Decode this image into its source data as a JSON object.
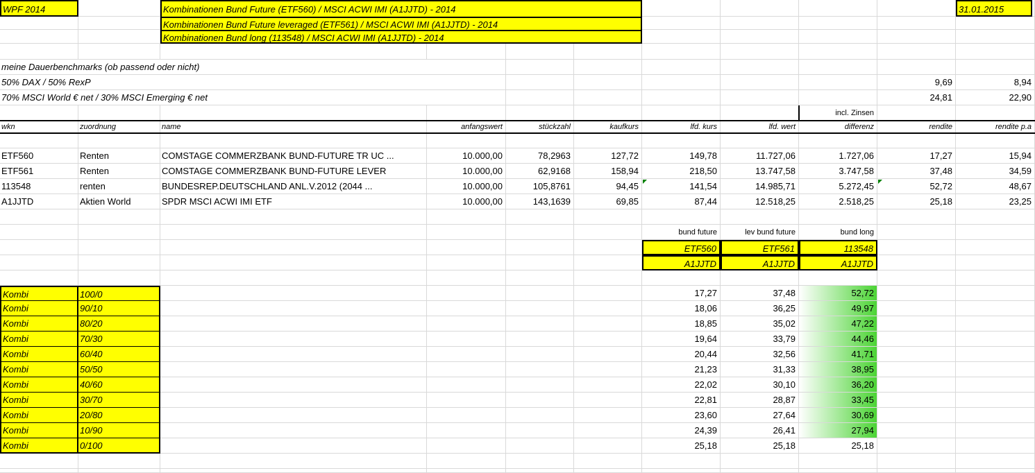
{
  "header": {
    "wpf": "WPF 2014",
    "titles": [
      "Kombinationen Bund Future (ETF560) / MSCI ACWI IMI (A1JJTD) - 2014",
      "Kombinationen Bund Future leveraged (ETF561) / MSCI ACWI IMI (A1JJTD) - 2014",
      "Kombinationen Bund long (113548) / MSCI ACWI IMI (A1JJTD) - 2014"
    ],
    "date": "31.01.2015"
  },
  "benchmarks": {
    "title": "meine Dauerbenchmarks (ob passend oder nicht)",
    "rows": [
      {
        "label": "50% DAX / 50% RexP",
        "rendite": "9,69",
        "rendite_pa": "8,94"
      },
      {
        "label": "70% MSCI World € net / 30% MSCI Emerging € net",
        "rendite": "24,81",
        "rendite_pa": "22,90"
      }
    ]
  },
  "table": {
    "incl_note": "incl. Zinsen",
    "columns": [
      "wkn",
      "zuordnung",
      "name",
      "anfangswert",
      "stückzahl",
      "kaufkurs",
      "lfd. kurs",
      "lfd. wert",
      "differenz",
      "rendite",
      "rendite p.a"
    ],
    "rows": [
      [
        "ETF560",
        "Renten",
        "COMSTAGE COMMERZBANK BUND-FUTURE TR UC ...",
        "10.000,00",
        "78,2963",
        "127,72",
        "149,78",
        "11.727,06",
        "1.727,06",
        "17,27",
        "15,94"
      ],
      [
        "ETF561",
        "Renten",
        "COMSTAGE COMMERZBANK BUND-FUTURE LEVER",
        "10.000,00",
        "62,9168",
        "158,94",
        "218,50",
        "13.747,58",
        "3.747,58",
        "37,48",
        "34,59"
      ],
      [
        "113548",
        "renten",
        "BUNDESREP.DEUTSCHLAND ANL.V.2012 (2044 ...",
        "10.000,00",
        "105,8761",
        "94,45",
        "141,54",
        "14.985,71",
        "5.272,45",
        "52,72",
        "48,67"
      ],
      [
        "A1JJTD",
        "Aktien World",
        "SPDR MSCI ACWI IMI ETF",
        "10.000,00",
        "143,1639",
        "69,85",
        "87,44",
        "12.518,25",
        "2.518,25",
        "25,18",
        "23,25"
      ]
    ]
  },
  "kombi": {
    "headers": [
      "bund future",
      "lev bund future",
      "bund long"
    ],
    "top_codes": [
      "ETF560",
      "ETF561",
      "113548"
    ],
    "bottom_codes": [
      "A1JJTD",
      "A1JJTD",
      "A1JJTD"
    ],
    "rows": [
      {
        "label": "Kombi",
        "mix": "100/0",
        "bund_future": "17,27",
        "lev_bund_future": "37,48",
        "bund_long": "52,72"
      },
      {
        "label": "Kombi",
        "mix": "90/10",
        "bund_future": "18,06",
        "lev_bund_future": "36,25",
        "bund_long": "49,97"
      },
      {
        "label": "Kombi",
        "mix": "80/20",
        "bund_future": "18,85",
        "lev_bund_future": "35,02",
        "bund_long": "47,22"
      },
      {
        "label": "Kombi",
        "mix": "70/30",
        "bund_future": "19,64",
        "lev_bund_future": "33,79",
        "bund_long": "44,46"
      },
      {
        "label": "Kombi",
        "mix": "60/40",
        "bund_future": "20,44",
        "lev_bund_future": "32,56",
        "bund_long": "41,71"
      },
      {
        "label": "Kombi",
        "mix": "50/50",
        "bund_future": "21,23",
        "lev_bund_future": "31,33",
        "bund_long": "38,95"
      },
      {
        "label": "Kombi",
        "mix": "40/60",
        "bund_future": "22,02",
        "lev_bund_future": "30,10",
        "bund_long": "36,20"
      },
      {
        "label": "Kombi",
        "mix": "30/70",
        "bund_future": "22,81",
        "lev_bund_future": "28,87",
        "bund_long": "33,45"
      },
      {
        "label": "Kombi",
        "mix": "20/80",
        "bund_future": "23,60",
        "lev_bund_future": "27,64",
        "bund_long": "30,69"
      },
      {
        "label": "Kombi",
        "mix": "10/90",
        "bund_future": "24,39",
        "lev_bund_future": "26,41",
        "bund_long": "27,94"
      },
      {
        "label": "Kombi",
        "mix": "0/100",
        "bund_future": "25,18",
        "lev_bund_future": "25,18",
        "bund_long": "25,18"
      }
    ]
  },
  "colors": {
    "highlight": "#ffff00",
    "gradient_green": "#4cd435",
    "grid": "#d9d9d9"
  }
}
